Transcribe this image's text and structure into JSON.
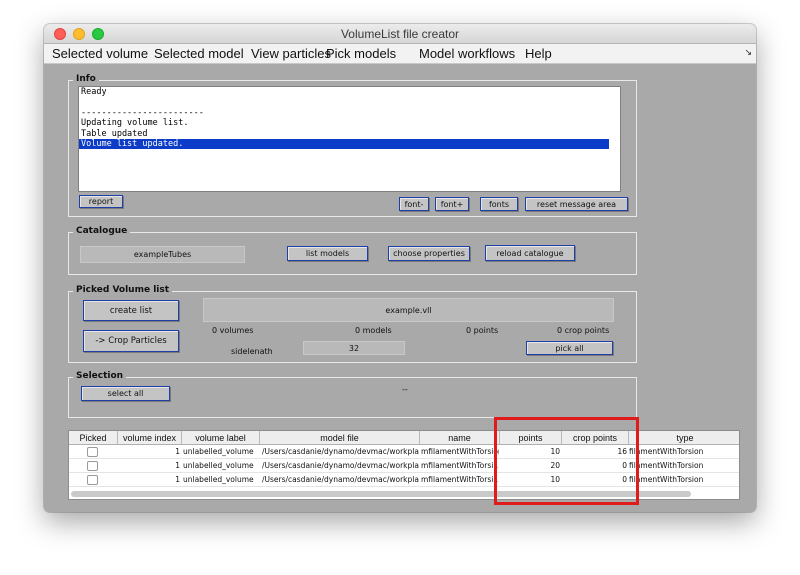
{
  "window": {
    "title": "VolumeList file creator"
  },
  "menu": [
    "Selected volume",
    "Selected model",
    "View particles",
    "Pick models",
    "Model workflows",
    "Help"
  ],
  "info": {
    "title": "Info",
    "log": [
      "Ready",
      "",
      "------------------------",
      "Updating volume list.",
      "Table updated",
      "Volume list updated."
    ],
    "buttons": {
      "report": "report",
      "font_minus": "font-",
      "font_plus": "font+",
      "fonts": "fonts",
      "reset": "reset message area"
    }
  },
  "catalogue": {
    "title": "Catalogue",
    "name": "exampleTubes",
    "buttons": {
      "list_models": "list models",
      "choose_properties": "choose properties",
      "reload": "reload catalogue"
    }
  },
  "picked": {
    "title": "Picked Volume list",
    "create_list": "create list",
    "crop_particles": "-> Crop Particles",
    "filename": "example.vll",
    "volumes": "0 volumes",
    "models": "0 models",
    "points": "0 points",
    "crop_points": "0 crop points",
    "sidelength_label": "sidelenath",
    "sidelength_value": "32",
    "pick_all": "pick all"
  },
  "selection": {
    "title": "Selection",
    "select_all": "select all",
    "value": "--"
  },
  "table": {
    "columns": [
      "Picked",
      "volume index",
      "volume label",
      "model file",
      "name",
      "points",
      "crop points",
      "type"
    ],
    "rows": [
      {
        "index": "1",
        "label": "unlabelled_volume",
        "model_file": "/Users/casdanie/dynamo/devmac/workplac...",
        "name": "mfilamentWithTorsion",
        "points": "10",
        "crop_points": "16",
        "type": "filamentWithTorsion"
      },
      {
        "index": "1",
        "label": "unlabelled_volume",
        "model_file": "/Users/casdanie/dynamo/devmac/workplac...",
        "name": "mfilamentWithTorsi...",
        "points": "20",
        "crop_points": "0",
        "type": "filamentWithTorsion"
      },
      {
        "index": "1",
        "label": "unlabelled_volume",
        "model_file": "/Users/casdanie/dynamo/devmac/workplac...",
        "name": "mfilamentWithTorsi...",
        "points": "10",
        "crop_points": "0",
        "type": "filamentWithTorsion"
      }
    ]
  },
  "colors": {
    "window_bg": "#a9a9a9",
    "selection_blue": "#0c3cc8",
    "highlight_red": "#e01b1b",
    "button_border": "#1d3fa6"
  }
}
